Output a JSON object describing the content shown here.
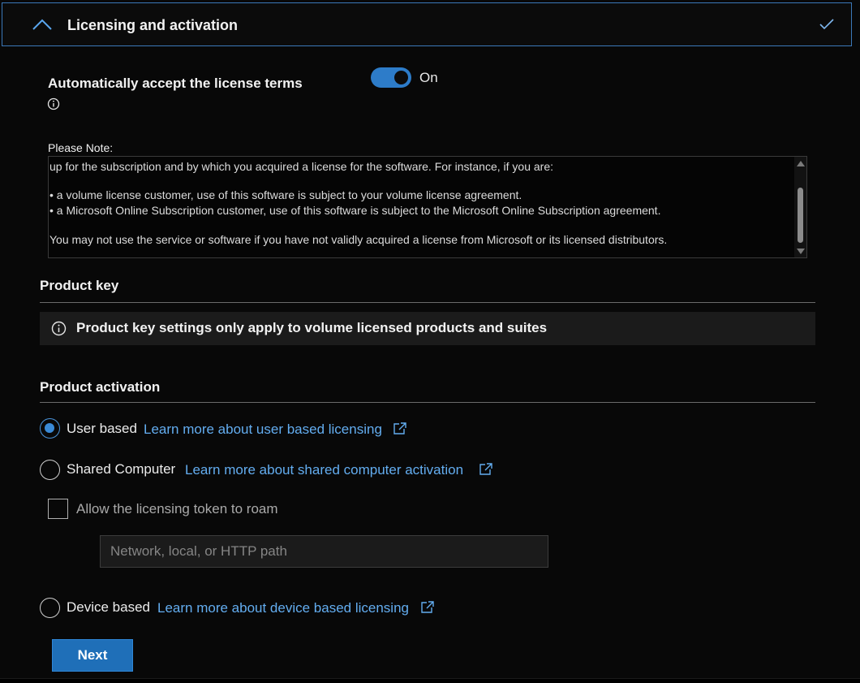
{
  "section": {
    "title": "Licensing and activation",
    "collapse_icon": "chevron-up-icon",
    "status_icon": "checkmark-icon"
  },
  "license": {
    "auto_accept_label": "Automatically accept the license terms",
    "info_icon": "info-icon",
    "toggle_state": "On",
    "toggle_on": true,
    "note_label": "Please Note:",
    "note_lines": [
      "up for the subscription and by which you acquired a license for the software. For instance, if you are:",
      "• a volume license customer, use of this software is subject to your volume license agreement.",
      "• a Microsoft Online Subscription customer, use of this software is subject to the Microsoft Online Subscription agreement.",
      "You may not use the service or software if you have not validly acquired a license from Microsoft or its licensed distributors."
    ]
  },
  "product_key": {
    "heading": "Product key",
    "info_text": "Product key settings only apply to volume licensed products and suites"
  },
  "activation": {
    "heading": "Product activation",
    "options": [
      {
        "label": "User based",
        "link": "Learn more about user based licensing",
        "checked": true
      },
      {
        "label": "Shared Computer",
        "link": "Learn more about shared computer activation",
        "checked": false
      },
      {
        "label": "Device based",
        "link": "Learn more about device based licensing",
        "checked": false
      }
    ],
    "roam_label": "Allow the licensing token to roam",
    "roam_checked": false,
    "path_placeholder": "Network, local, or HTTP path",
    "path_value": ""
  },
  "footer": {
    "next_label": "Next"
  },
  "colors": {
    "accent": "#2d7cc9",
    "link": "#63adf0",
    "button": "#1f6fb8",
    "background": "#080808"
  }
}
